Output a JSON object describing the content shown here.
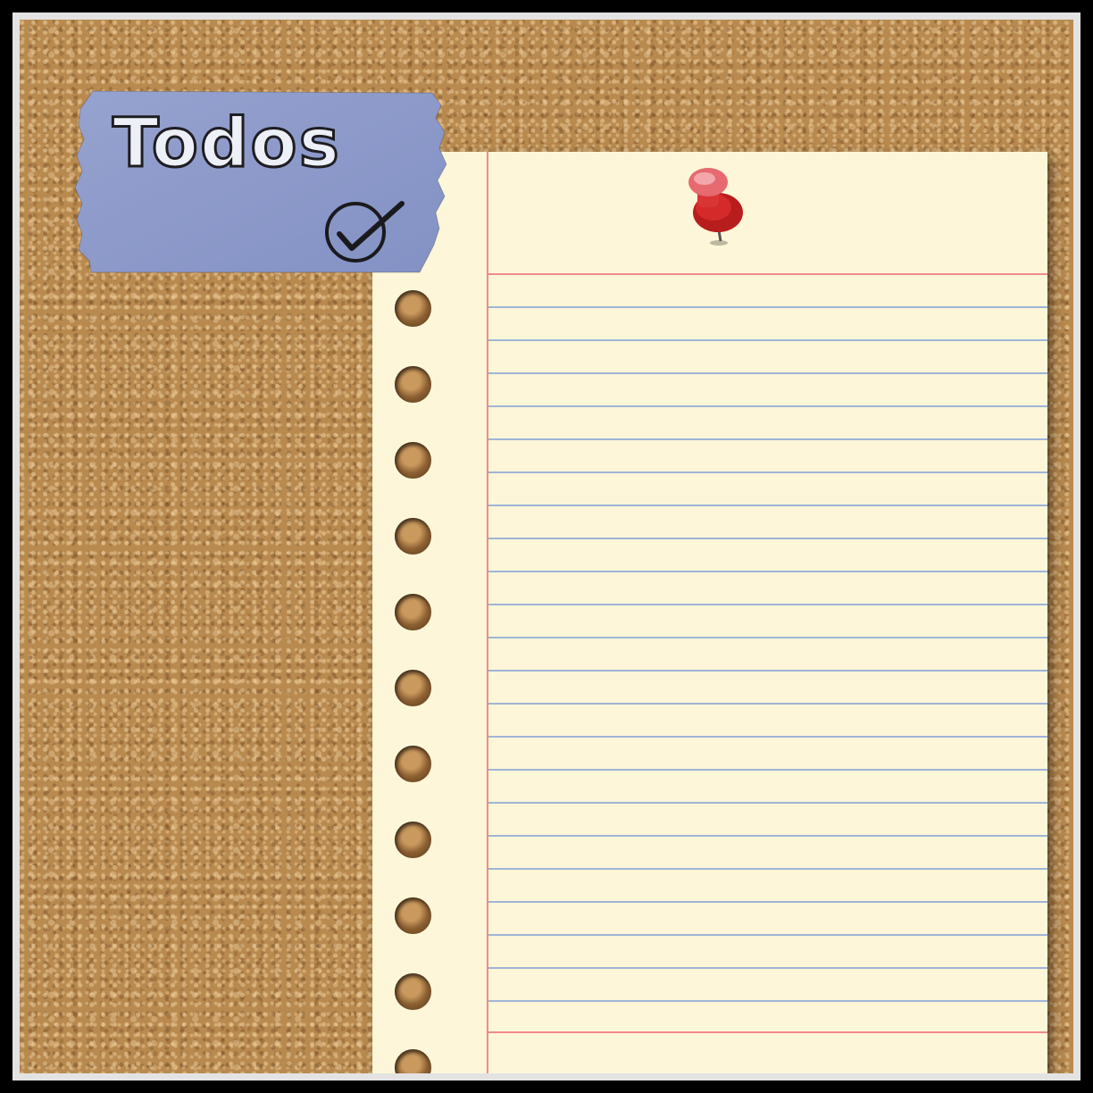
{
  "label": {
    "title": "Todos",
    "icon": "checkmark-circle-icon"
  },
  "pin_icon": "push-pin-icon",
  "colors": {
    "cork": "#b98a4f",
    "paper": "#fdf6d8",
    "blue_rule": "#9fb4d8",
    "red_rule": "#f08a8a",
    "tape": "#8f9cc9",
    "pin": "#d42a2a"
  }
}
